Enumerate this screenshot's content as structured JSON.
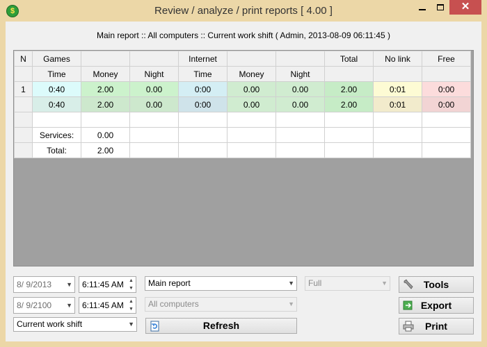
{
  "window": {
    "title": "Review / analyze / print reports [ 4.00 ]",
    "icon_glyph": "$",
    "minimize_glyph": "",
    "close_glyph": "✕"
  },
  "report_header": "Main report :: All computers :: Current work shift ( Admin, 2013-08-09 06:11:45 )",
  "grid": {
    "group_headers": {
      "n": "N",
      "games": "Games",
      "internet": "Internet",
      "total": "Total",
      "no_link": "No link",
      "free": "Free"
    },
    "sub_headers": {
      "games_time": "Time",
      "games_money": "Money",
      "games_night": "Night",
      "internet_time": "Time",
      "internet_money": "Money",
      "internet_night": "Night"
    },
    "rows": [
      {
        "n": "1",
        "games_time": "0:40",
        "games_money": "2.00",
        "games_night": "0.00",
        "internet_time": "0:00",
        "internet_money": "0.00",
        "internet_night": "0.00",
        "total": "2.00",
        "no_link": "0:01",
        "free": "0:00"
      },
      {
        "n": "",
        "games_time": "0:40",
        "games_money": "2.00",
        "games_night": "0.00",
        "internet_time": "0:00",
        "internet_money": "0.00",
        "internet_night": "0.00",
        "total": "2.00",
        "no_link": "0:01",
        "free": "0:00"
      }
    ],
    "services_label": "Services:",
    "services_value": "0.00",
    "total_label": "Total:",
    "total_value": "2.00"
  },
  "controls": {
    "date_from": "8/  9/2013",
    "time_from": "6:11:45 AM",
    "date_to": "8/  9/2100",
    "time_to": "6:11:45 AM",
    "shift_select": "Current work shift",
    "report_select": "Main report",
    "computers_select": "All computers",
    "detail_select": "Full",
    "refresh_label": "Refresh",
    "tools_label": "Tools",
    "export_label": "Export",
    "print_label": "Print"
  },
  "colors": {
    "title_bar": "#ecd7a7",
    "close_button": "#c75050",
    "grid_empty_area": "#a0a0a0"
  }
}
